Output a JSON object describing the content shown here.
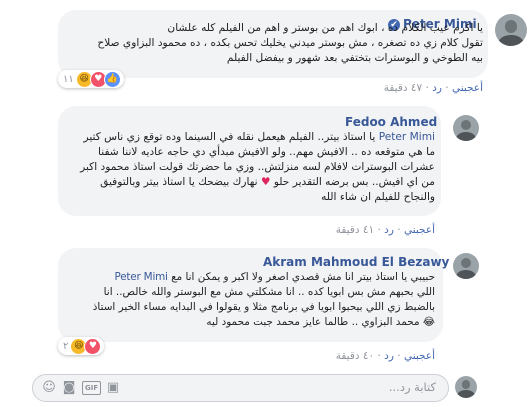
{
  "comments": [
    {
      "author": "Peter Mimi",
      "verified": true,
      "lines": [
        "يا اكرم عيب الكلام ده ، ابوك اهم من بوستر و اهم من الفيلم كله علشان",
        "تقول كلام زي ده تصغره ، مش بوستر ميدني يخليك تحس بكده ، ده محمود البزاوي صلاح",
        "بيه الطوخي و البوسترات بتختفي بعد شهور و بيفضل الفيلم"
      ],
      "like_label": "أعجبني",
      "reply_label": "رد",
      "time": "٤٧ دقيقة",
      "reaction_count": "١١",
      "reactions": [
        "like-icon",
        "love-icon",
        "haha-icon"
      ]
    },
    {
      "author": "Fedoo Ahmed",
      "mention": "Peter Mimi",
      "lines_after_mention": "يا استاذ بيتر.. الفيلم هيعمل نقله في السينما وده توقع زي ناس كتير",
      "lines": [
        "ما هي متوقعه ده .. الافيش مهم.. ولو الافيش مبدأي دي حاجه عاديه لاننا شفنا",
        "عشرات البوسترات لافلام لسه منزلتش.. وزي ما حضرتك قولت استاذ محمود اكبر",
        "من اي افيش.. بس برضه التقدير حلو",
        "والنجاح للفيلم ان شاء الله"
      ],
      "line4_after_heart": "نهارك بيضحك يا استاذ بيتر وبالتوفيق",
      "like_label": "أعجبني",
      "reply_label": "رد",
      "time": "٤١ دقيقة"
    },
    {
      "author": "Akram Mahmoud El Bezawy",
      "line1_before_mention": "حبيبي يا استاذ بيتر انا مش قصدي اصغر ولا اكبر و يمكن انا مع",
      "mention": "Peter Mimi",
      "lines": [
        "اللي بحبهم مش بس ابويا كده .. انا مشكلتي مش مع البوستر والله خالص.. انا",
        "بالضبط زي اللي بيحبوا ابويا في برنامج مثلا و يقولوا في البدايه مساء الخير استاذ",
        "محمد البزاوي .. طالما عايز محمد جبت محمود ليه"
      ],
      "like_label": "أعجبني",
      "reply_label": "رد",
      "time": "٤٠ دقيقة",
      "reaction_count": "٢",
      "reactions": [
        "love-icon",
        "haha-icon"
      ]
    }
  ],
  "composer": {
    "placeholder": "كتابة رد...",
    "gif_label": "GIF"
  }
}
